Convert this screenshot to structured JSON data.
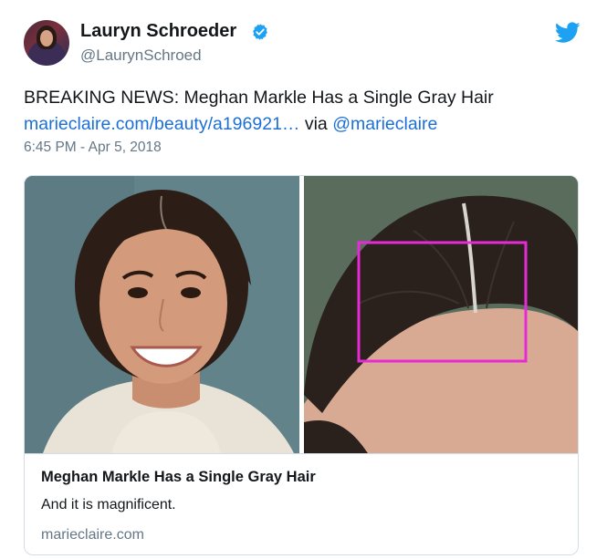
{
  "author": {
    "name": "Lauryn Schroeder",
    "handle": "@LaurynSchroed"
  },
  "tweet": {
    "text_prefix": "BREAKING NEWS: Meghan Markle Has a Single Gray Hair",
    "link_text": "marieclaire.com/beauty/a196921…",
    "via_text": " via ",
    "mention": "@marieclaire",
    "timestamp": "6:45 PM - Apr 5, 2018"
  },
  "card": {
    "title": "Meghan Markle Has a Single Gray Hair",
    "description": "And it is magnificent.",
    "domain": "marieclaire.com"
  },
  "icons": {
    "verified": "verified-badge-icon",
    "platform": "twitter-bird-icon"
  },
  "colors": {
    "link": "#1b6fd6",
    "verified": "#1da1f2",
    "bird": "#1da1f2",
    "secondary_text": "#657786",
    "highlight_box": "#e62ad6"
  }
}
